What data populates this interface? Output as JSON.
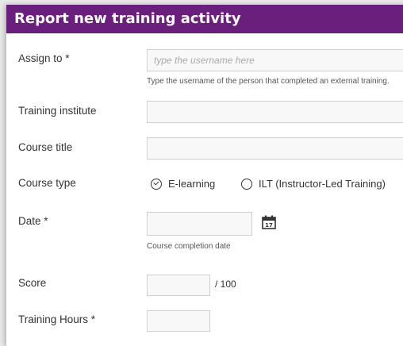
{
  "modal": {
    "title": "Report new training activity"
  },
  "fields": {
    "assign_to": {
      "label": "Assign to *",
      "placeholder": "type the username here",
      "help": "Type the username of the person that completed an external training."
    },
    "training_institute": {
      "label": "Training institute",
      "value": ""
    },
    "course_title": {
      "label": "Course title",
      "value": ""
    },
    "course_type": {
      "label": "Course type",
      "options": [
        "E-learning",
        "ILT (Instructor-Led Training)"
      ],
      "selected": "E-learning"
    },
    "date": {
      "label": "Date *",
      "value": "",
      "help": "Course completion date",
      "icon": "calendar-icon",
      "icon_day": "17"
    },
    "score": {
      "label": "Score",
      "value": "",
      "suffix": "/ 100"
    },
    "training_hours": {
      "label": "Training Hours *",
      "value": ""
    }
  },
  "colors": {
    "header_bg": "#6b1f7c",
    "header_text": "#ffffff"
  }
}
